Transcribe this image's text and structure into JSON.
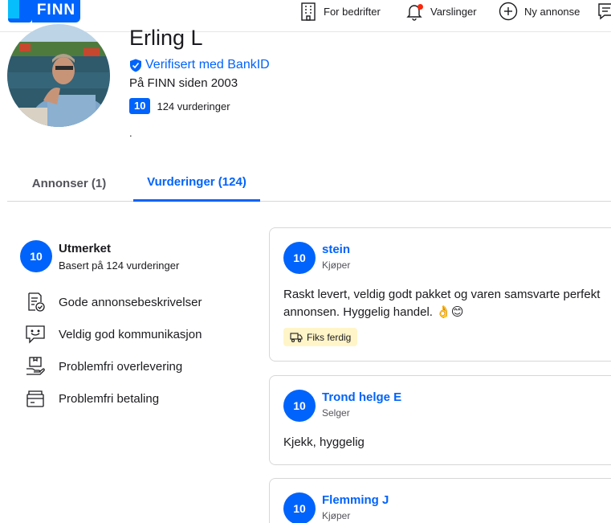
{
  "header": {
    "logo_text": "FINN",
    "nav": {
      "business": "For bedrifter",
      "notifications": "Varslinger",
      "new_ad": "Ny annonse"
    }
  },
  "profile": {
    "name": "Erling L",
    "verified": "Verifisert med BankID",
    "since": "På FINN siden 2003",
    "score": "10",
    "ratings_count": "124 vurderinger",
    "extra": "."
  },
  "tabs": [
    {
      "label": "Annonser (1)",
      "active": false
    },
    {
      "label": "Vurderinger (124)",
      "active": true
    }
  ],
  "summary": {
    "score": "10",
    "title": "Utmerket",
    "subtitle": "Basert på 124 vurderinger",
    "attributes": [
      {
        "label": "Gode annonsebeskrivelser",
        "icon": "document-check-icon"
      },
      {
        "label": "Veldig god kommunikasjon",
        "icon": "chat-smile-icon"
      },
      {
        "label": "Problemfri overlevering",
        "icon": "package-hand-icon"
      },
      {
        "label": "Problemfri betaling",
        "icon": "wallet-card-icon"
      }
    ]
  },
  "reviews": [
    {
      "score": "10",
      "name": "stein",
      "role": "Kjøper",
      "text": "Raskt levert, veldig godt pakket og varen samsvarte perfekt annonsen. Hyggelig handel. 👌😊",
      "badge": "Fiks ferdig"
    },
    {
      "score": "10",
      "name": "Trond helge E",
      "role": "Selger",
      "text": "Kjekk, hyggelig"
    },
    {
      "score": "10",
      "name": "Flemming J",
      "role": "Kjøper"
    }
  ],
  "colors": {
    "brand_blue": "#0063fb",
    "brand_light_blue": "#06befb",
    "badge_yellow": "#fff5c8",
    "notification_red": "#fa270c"
  }
}
